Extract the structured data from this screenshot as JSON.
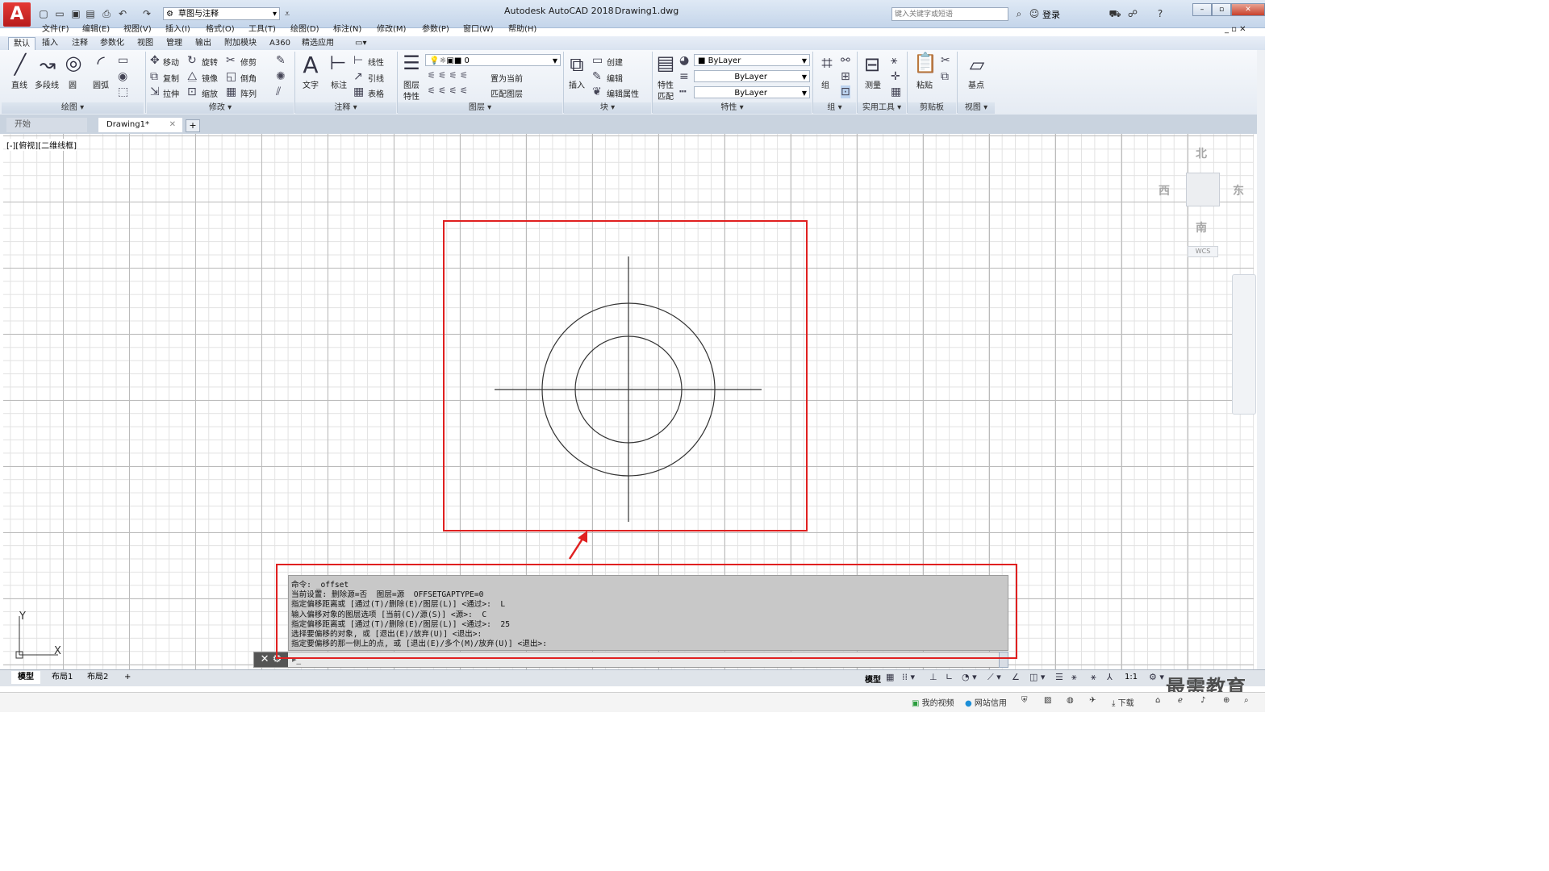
{
  "titlebar": {
    "app_title": "Autodesk AutoCAD 2018",
    "document": "Drawing1.dwg",
    "workspace": "草图与注释",
    "search_placeholder": "键入关键字或短语",
    "login": "登录"
  },
  "menu": [
    "文件(F)",
    "编辑(E)",
    "视图(V)",
    "插入(I)",
    "格式(O)",
    "工具(T)",
    "绘图(D)",
    "标注(N)",
    "修改(M)",
    "参数(P)",
    "窗口(W)",
    "帮助(H)"
  ],
  "ribbon_tabs": [
    "默认",
    "插入",
    "注释",
    "参数化",
    "视图",
    "管理",
    "输出",
    "附加模块",
    "A360",
    "精选应用"
  ],
  "ribbon": {
    "draw": {
      "title": "绘图",
      "line": "直线",
      "polyline": "多段线",
      "circle": "圆",
      "arc": "圆弧"
    },
    "modify": {
      "title": "修改",
      "move": "移动",
      "rotate": "旋转",
      "trim": "修剪",
      "copy": "复制",
      "mirror": "镜像",
      "fillet": "倒角",
      "stretch": "拉伸",
      "scale": "缩放",
      "array": "阵列"
    },
    "annotation": {
      "title": "注释",
      "text": "文字",
      "dimension": "标注",
      "linear": "线性",
      "leader": "引线",
      "table": "表格"
    },
    "layers": {
      "title": "图层",
      "properties_a": "图层",
      "properties_b": "特性",
      "layer_value": "0",
      "set_current": "置为当前",
      "match_layer": "匹配图层"
    },
    "block": {
      "title": "块",
      "insert": "插入",
      "create": "创建",
      "edit": "编辑",
      "edit_attr": "编辑属性"
    },
    "properties": {
      "title": "特性",
      "match_a": "特性",
      "match_b": "匹配",
      "color": "ByLayer",
      "linetype": "ByLayer",
      "lineweight": "ByLayer"
    },
    "groups": {
      "title": "组",
      "group": "组"
    },
    "utilities": {
      "title": "实用工具",
      "measure": "测量"
    },
    "clipboard": {
      "title": "剪贴板",
      "paste": "粘贴"
    },
    "view": {
      "title": "视图",
      "base": "基点"
    }
  },
  "file_tabs": {
    "start": "开始",
    "drawing": "Drawing1*"
  },
  "viewport_label": "[-][俯视][二维线框]",
  "viewcube": {
    "north": "北",
    "south": "南",
    "east": "东",
    "west": "西",
    "wcs": "WCS"
  },
  "command_history": [
    "命令: _offset",
    "当前设置: 删除源=否  图层=源  OFFSETGAPTYPE=0",
    "指定偏移距离或 [通过(T)/删除(E)/图层(L)] <通过>:  L",
    "输入偏移对象的图层选项 [当前(C)/源(S)] <源>:  C",
    "指定偏移距离或 [通过(T)/删除(E)/图层(L)] <通过>:  25",
    "选择要偏移的对象, 或 [退出(E)/放弃(U)] <退出>:",
    "指定要偏移的那一侧上的点, 或 [退出(E)/多个(M)/放弃(U)] <退出>:"
  ],
  "ucs": {
    "x": "X",
    "y": "Y"
  },
  "layout_tabs": [
    "模型",
    "布局1",
    "布局2"
  ],
  "status": {
    "model": "模型",
    "scale": "1:1"
  },
  "taskbar": {
    "video": "我的视频",
    "net": "网站信用",
    "download": "下载"
  },
  "watermark": "最需教育",
  "colors": {
    "highlight": "#e02020",
    "brand": "#c62828"
  }
}
